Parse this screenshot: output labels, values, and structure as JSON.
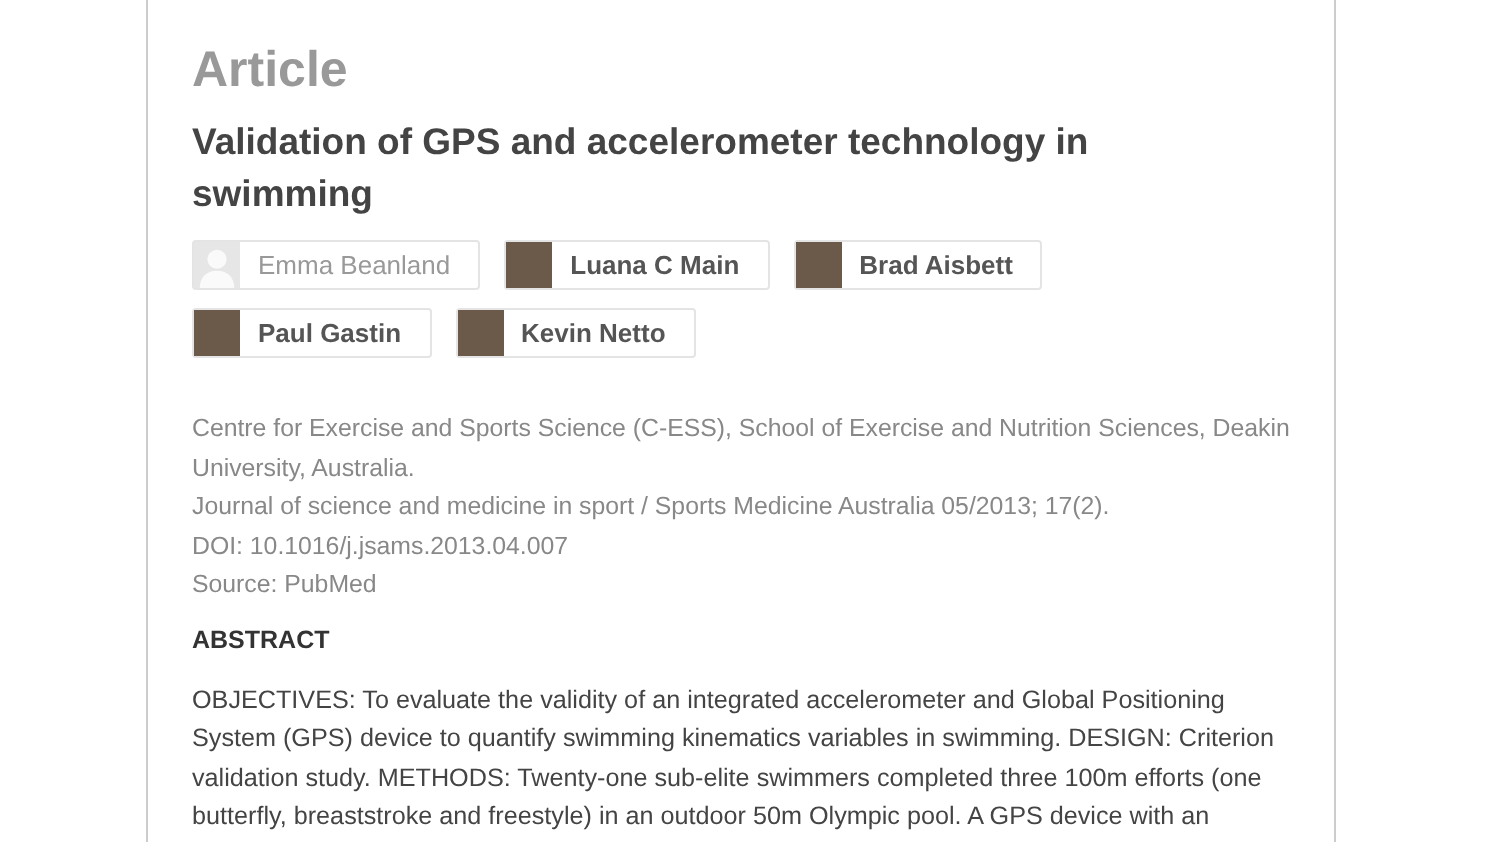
{
  "header": {
    "type_label": "Article",
    "title": "Validation of GPS and accelerometer technology in swimming"
  },
  "authors": [
    {
      "name": "Emma Beanland",
      "has_profile": false
    },
    {
      "name": "Luana C Main",
      "has_profile": true
    },
    {
      "name": "Brad Aisbett",
      "has_profile": true
    },
    {
      "name": "Paul Gastin",
      "has_profile": true
    },
    {
      "name": "Kevin Netto",
      "has_profile": true
    }
  ],
  "details": [
    "Centre for Exercise and Sports Science (C-ESS), School of Exercise and Nutrition Sciences, Deakin University, Australia.",
    "Journal of science and medicine in sport / Sports Medicine Australia 05/2013; 17(2).",
    "DOI: 10.1016/j.jsams.2013.04.007",
    "Source: PubMed"
  ],
  "abstract": {
    "heading": "ABSTRACT",
    "text": "OBJECTIVES: To evaluate the validity of an integrated accelerometer and Global Positioning System (GPS) device to quantify swimming kinematics variables in swimming. DESIGN: Criterion validation study. METHODS: Twenty-one sub-elite swimmers completed three 100m efforts (one butterfly, breaststroke and freestyle) in an outdoor 50m Olympic pool. A GPS device with an"
  }
}
